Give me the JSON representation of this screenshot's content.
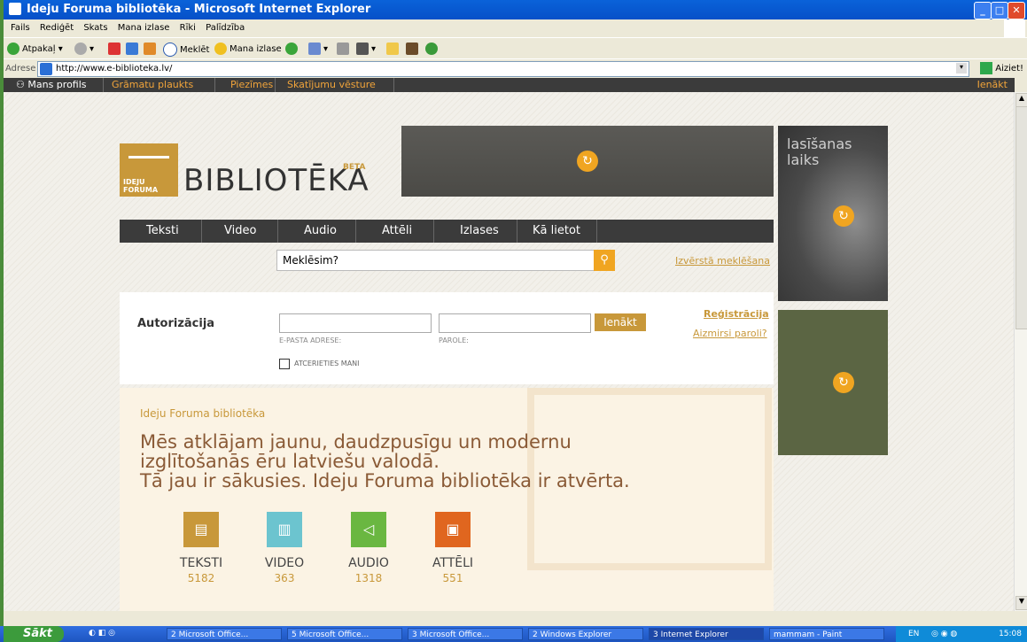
{
  "window": {
    "title": "Ideju Foruma bibliotēka - Microsoft Internet Explorer"
  },
  "menu": [
    "Fails",
    "Rediģēt",
    "Skats",
    "Mana izlase",
    "Rīki",
    "Palīdzība"
  ],
  "toolbar": {
    "back": "Atpakaļ",
    "search": "Meklēt",
    "favorites": "Mana izlase"
  },
  "address": {
    "label": "Adrese",
    "url": "http://www.e-biblioteka.lv/",
    "go": "Aiziet!"
  },
  "sitebar": {
    "profile": "Mans profils",
    "items": [
      "Grāmatu plaukts",
      "Piezīmes",
      "Skatījumu vēsture"
    ],
    "login": "Ienākt"
  },
  "brand": {
    "logo_text": "IDEJU FORUMA",
    "name": "BIBLIOTĒKA",
    "beta": "BETA"
  },
  "side": {
    "promo_title_line1": "lasīšanas",
    "promo_title_line2": "laiks"
  },
  "nav": [
    "Teksti",
    "Video",
    "Audio",
    "Attēli",
    "Izlases",
    "Kā lietot"
  ],
  "search": {
    "placeholder": "Meklēsim?",
    "advanced": "Izvērstā meklēšana"
  },
  "auth": {
    "heading": "Autorizācija",
    "email_label": "E-PASTA ADRESE:",
    "password_label": "PAROLE:",
    "login": "Ienākt",
    "register": "Reģistrācija",
    "forgot": "Aizmirsi paroli?",
    "remember": "ATCERIETIES MANI"
  },
  "promo": {
    "subtitle": "Ideju Foruma bibliotēka",
    "line1": "Mēs atklājam jaunu, daudzpusīgu un modernu",
    "line2": "izglītošanās ēru latviešu valodā.",
    "line3": "Tā jau ir sākusies. Ideju Foruma bibliotēka ir atvērta."
  },
  "categories": [
    {
      "name": "TEKSTI",
      "count": "5182",
      "color": "#c8983a"
    },
    {
      "name": "VIDEO",
      "count": "363",
      "color": "#6cc4cf"
    },
    {
      "name": "AUDIO",
      "count": "1318",
      "color": "#6ab741"
    },
    {
      "name": "ATTĒLI",
      "count": "551",
      "color": "#e0661f"
    }
  ],
  "taskbar": {
    "start": "Sākt",
    "tasks": [
      "2 Microsoft Office...",
      "5 Microsoft Office...",
      "3 Microsoft Office...",
      "2 Windows Explorer",
      "3 Internet Explorer",
      "mammam - Paint"
    ],
    "lang": "EN",
    "time": "15:08"
  }
}
